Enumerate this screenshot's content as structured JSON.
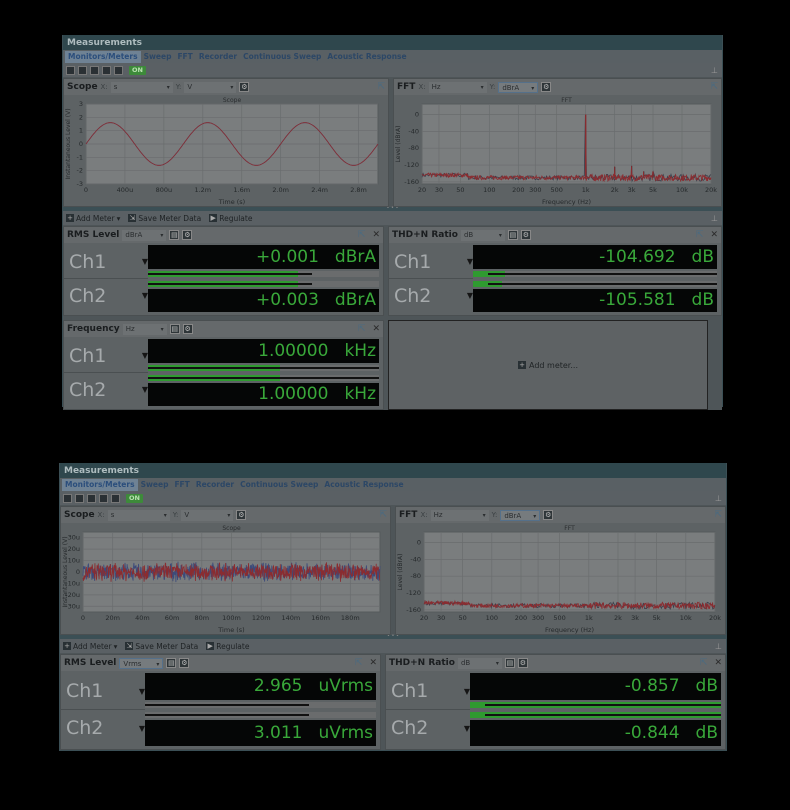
{
  "windows": [
    {
      "title": "Measurements",
      "tabs": [
        "Monitors/Meters",
        "Sweep",
        "FFT",
        "Recorder",
        "Continuous Sweep",
        "Acoustic Response"
      ],
      "active_tab": 0,
      "on_label": "ON",
      "scope": {
        "title": "Scope",
        "x_label": "X:",
        "x_unit": "s",
        "y_label": "Y:",
        "y_unit": "V",
        "plot_title": "Scope",
        "xlabel": "Time (s)",
        "ylabel": "Instantaneous Level (V)",
        "xlim": [
          0,
          0.003
        ],
        "ylim": [
          -3,
          3
        ],
        "xticks": [
          {
            "v": 0,
            "t": "0"
          },
          {
            "v": 0.0004,
            "t": "400u"
          },
          {
            "v": 0.0008,
            "t": "800u"
          },
          {
            "v": 0.0012,
            "t": "1.2m"
          },
          {
            "v": 0.0016,
            "t": "1.6m"
          },
          {
            "v": 0.002,
            "t": "2.0m"
          },
          {
            "v": 0.0024,
            "t": "2.4m"
          },
          {
            "v": 0.0028,
            "t": "2.8m"
          }
        ],
        "yticks": [
          {
            "v": 3,
            "t": "3"
          },
          {
            "v": 2,
            "t": "2"
          },
          {
            "v": 1,
            "t": "1"
          },
          {
            "v": 0,
            "t": "0"
          },
          {
            "v": -1,
            "t": "-1"
          },
          {
            "v": -2,
            "t": "-2"
          },
          {
            "v": -3,
            "t": "-3"
          }
        ],
        "signal": {
          "type": "sine",
          "amplitude": 1.6,
          "frequency": 1000
        },
        "trace_colors": [
          "#3c4a7a",
          "#8a2c30"
        ]
      },
      "fft": {
        "title": "FFT",
        "x_label": "X:",
        "x_unit": "Hz",
        "y_label": "Y:",
        "y_unit": "dBrA",
        "plot_title": "FFT",
        "xlabel": "Frequency (Hz)",
        "ylabel": "Level (dBrA)",
        "xlim": [
          20,
          20000
        ],
        "ylim": [
          -165,
          25
        ],
        "xticks": [
          {
            "v": 20,
            "t": "20"
          },
          {
            "v": 30,
            "t": "30"
          },
          {
            "v": 50,
            "t": "50"
          },
          {
            "v": 100,
            "t": "100"
          },
          {
            "v": 200,
            "t": "200"
          },
          {
            "v": 300,
            "t": "300"
          },
          {
            "v": 500,
            "t": "500"
          },
          {
            "v": 1000,
            "t": "1k"
          },
          {
            "v": 2000,
            "t": "2k"
          },
          {
            "v": 3000,
            "t": "3k"
          },
          {
            "v": 5000,
            "t": "5k"
          },
          {
            "v": 10000,
            "t": "10k"
          },
          {
            "v": 20000,
            "t": "20k"
          }
        ],
        "yticks": [
          {
            "v": 0,
            "t": "0"
          },
          {
            "v": -40,
            "t": "-40"
          },
          {
            "v": -80,
            "t": "-80"
          },
          {
            "v": -120,
            "t": "-120"
          },
          {
            "v": -160,
            "t": "-160"
          }
        ],
        "noise_floor": -150,
        "peaks": [
          {
            "freq": 1000,
            "level": 0
          },
          {
            "freq": 2000,
            "level": -124
          },
          {
            "freq": 3000,
            "level": -122
          },
          {
            "freq": 4000,
            "level": -135
          },
          {
            "freq": 5000,
            "level": -136
          }
        ],
        "trace_colors": [
          "#3a3d4a",
          "#8a2c30"
        ]
      },
      "meter_toolbar": {
        "add_meter": "Add Meter",
        "save": "Save Meter Data",
        "regulate": "Regulate"
      },
      "meters": [
        {
          "title": "RMS Level",
          "unit": "dBrA",
          "channels": [
            {
              "name": "Ch1",
              "value": "+0.001",
              "unit": "dBrA",
              "fill": 0.65,
              "line_start": 0,
              "line_end": 0.71
            },
            {
              "name": "Ch2",
              "value": "+0.003",
              "unit": "dBrA",
              "fill": 0.65,
              "line_start": 0,
              "line_end": 0.71
            }
          ]
        },
        {
          "title": "THD+N Ratio",
          "unit": "dB",
          "channels": [
            {
              "name": "Ch1",
              "value": "-104.692",
              "unit": "dB",
              "fill": 0.13,
              "line_start": 0.06,
              "line_end": 1
            },
            {
              "name": "Ch2",
              "value": "-105.581",
              "unit": "dB",
              "fill": 0.12,
              "line_start": 0.06,
              "line_end": 1
            }
          ]
        },
        {
          "title": "Frequency",
          "unit": "Hz",
          "channels": [
            {
              "name": "Ch1",
              "value": "1.00000",
              "unit": "kHz",
              "fill": 0.57,
              "line_start": 0,
              "line_end": 1
            },
            {
              "name": "Ch2",
              "value": "1.00000",
              "unit": "kHz",
              "fill": 0.57,
              "line_start": 0,
              "line_end": 1
            }
          ]
        }
      ],
      "add_meter_placeholder": "Add meter..."
    },
    {
      "title": "Measurements",
      "tabs": [
        "Monitors/Meters",
        "Sweep",
        "FFT",
        "Recorder",
        "Continuous Sweep",
        "Acoustic Response"
      ],
      "active_tab": 0,
      "on_label": "ON",
      "scope": {
        "title": "Scope",
        "x_label": "X:",
        "x_unit": "s",
        "y_label": "Y:",
        "y_unit": "V",
        "plot_title": "Scope",
        "xlabel": "Time (s)",
        "ylabel": "Instantaneous Level (V)",
        "xlim": [
          0,
          0.2
        ],
        "ylim": [
          -3.5e-05,
          3.5e-05
        ],
        "xticks": [
          {
            "v": 0,
            "t": "0"
          },
          {
            "v": 0.02,
            "t": "20m"
          },
          {
            "v": 0.04,
            "t": "40m"
          },
          {
            "v": 0.06,
            "t": "60m"
          },
          {
            "v": 0.08,
            "t": "80m"
          },
          {
            "v": 0.1,
            "t": "100m"
          },
          {
            "v": 0.12,
            "t": "120m"
          },
          {
            "v": 0.14,
            "t": "140m"
          },
          {
            "v": 0.16,
            "t": "160m"
          },
          {
            "v": 0.18,
            "t": "180m"
          }
        ],
        "yticks": [
          {
            "v": 3e-05,
            "t": "30u"
          },
          {
            "v": 2e-05,
            "t": "20u"
          },
          {
            "v": 1e-05,
            "t": "10u"
          },
          {
            "v": 0,
            "t": "0"
          },
          {
            "v": -1e-05,
            "t": "-10u"
          },
          {
            "v": -2e-05,
            "t": "-20u"
          },
          {
            "v": -3e-05,
            "t": "-30u"
          }
        ],
        "signal": {
          "type": "noise",
          "amplitude": 7e-06
        },
        "trace_colors": [
          "#3c4a7a",
          "#8a2c30"
        ]
      },
      "fft": {
        "title": "FFT",
        "x_label": "X:",
        "x_unit": "Hz",
        "y_label": "Y:",
        "y_unit": "dBrA",
        "plot_title": "FFT",
        "xlabel": "Frequency (Hz)",
        "ylabel": "Level (dBrA)",
        "xlim": [
          20,
          20000
        ],
        "ylim": [
          -165,
          25
        ],
        "xticks": [
          {
            "v": 20,
            "t": "20"
          },
          {
            "v": 30,
            "t": "30"
          },
          {
            "v": 50,
            "t": "50"
          },
          {
            "v": 100,
            "t": "100"
          },
          {
            "v": 200,
            "t": "200"
          },
          {
            "v": 300,
            "t": "300"
          },
          {
            "v": 500,
            "t": "500"
          },
          {
            "v": 1000,
            "t": "1k"
          },
          {
            "v": 2000,
            "t": "2k"
          },
          {
            "v": 3000,
            "t": "3k"
          },
          {
            "v": 5000,
            "t": "5k"
          },
          {
            "v": 10000,
            "t": "10k"
          },
          {
            "v": 20000,
            "t": "20k"
          }
        ],
        "yticks": [
          {
            "v": 0,
            "t": "0"
          },
          {
            "v": -40,
            "t": "-40"
          },
          {
            "v": -80,
            "t": "-80"
          },
          {
            "v": -120,
            "t": "-120"
          },
          {
            "v": -160,
            "t": "-160"
          }
        ],
        "noise_floor": -150,
        "peaks": [],
        "trace_colors": [
          "#3a3d4a",
          "#8a2c30"
        ]
      },
      "meter_toolbar": {
        "add_meter": "Add Meter",
        "save": "Save Meter Data",
        "regulate": "Regulate"
      },
      "meters": [
        {
          "title": "RMS Level",
          "unit": "Vrms",
          "unit_highlight": true,
          "channels": [
            {
              "name": "Ch1",
              "value": "2.965",
              "unit": "uVrms",
              "fill": 0,
              "line_start": 0,
              "line_end": 0.71
            },
            {
              "name": "Ch2",
              "value": "3.011",
              "unit": "uVrms",
              "fill": 0,
              "line_start": 0,
              "line_end": 0.71
            }
          ]
        },
        {
          "title": "THD+N Ratio",
          "unit": "dB",
          "channels": [
            {
              "name": "Ch1",
              "value": "-0.857",
              "unit": "dB",
              "fill": 1,
              "line_start": 0.06,
              "line_end": 1
            },
            {
              "name": "Ch2",
              "value": "-0.844",
              "unit": "dB",
              "fill": 1,
              "line_start": 0.06,
              "line_end": 1
            }
          ]
        }
      ]
    }
  ]
}
